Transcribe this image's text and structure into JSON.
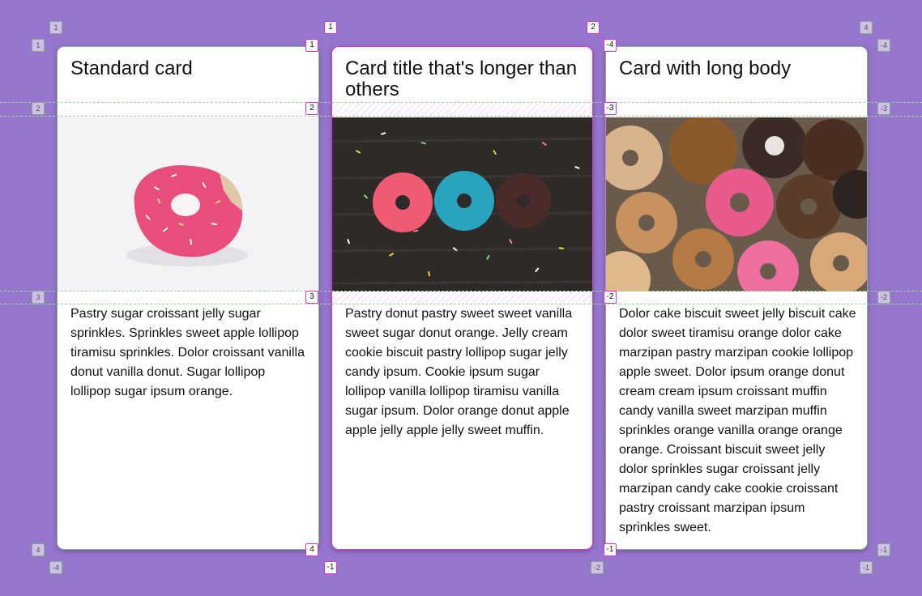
{
  "cards": [
    {
      "title": "Standard card",
      "body": "Pastry sugar croissant jelly sugar sprinkles. Sprinkles sweet apple lollipop tiramisu sprinkles. Dolor croissant vanilla donut vanilla donut. Sugar lollipop lollipop sugar ipsum orange.",
      "image_alt": "pink-frosted-donut-image"
    },
    {
      "title": "Card title that's longer than others",
      "body": "Pastry donut pastry sweet sweet vanilla sweet sugar donut orange. Jelly cream cookie biscuit pastry lollipop sugar jelly candy ipsum. Cookie ipsum sugar lollipop vanilla lollipop tiramisu vanilla sugar ipsum. Dolor orange donut apple apple jelly apple jelly sweet muffin.",
      "image_alt": "three-donuts-on-wood-image"
    },
    {
      "title": "Card with long body",
      "body": "Dolor cake biscuit sweet jelly biscuit cake dolor sweet tiramisu orange dolor cake marzipan pastry marzipan cookie lollipop apple sweet. Dolor ipsum orange donut cream cream ipsum croissant muffin candy vanilla sweet marzipan muffin sprinkles orange vanilla orange orange orange. Croissant biscuit sweet jelly dolor sprinkles sugar croissant jelly marzipan candy cake cookie croissant pastry croissant marzipan ipsum sprinkles sweet.",
      "image_alt": "assorted-donuts-image"
    }
  ],
  "grid_overlay": {
    "outer_col_top": [
      "1",
      "2",
      "4"
    ],
    "outer_col_bottom": [
      "-4",
      "-2",
      "-1"
    ],
    "outer_row_left": [
      "1",
      "2",
      "3",
      "4"
    ],
    "outer_row_right": [
      "-4",
      "-3",
      "-2",
      "-1"
    ],
    "active_col_top": [
      "1",
      "2"
    ],
    "active_col_bottom": [
      "-1"
    ],
    "active_row_left": [
      "1",
      "2",
      "3",
      "4"
    ],
    "active_row_right": [
      "-4",
      "-3",
      "-2",
      "-1"
    ]
  },
  "colors": {
    "background": "#9575cd",
    "card": "#ffffff",
    "grid_line": "#9ed49e",
    "active_outline": "#d633d6"
  }
}
